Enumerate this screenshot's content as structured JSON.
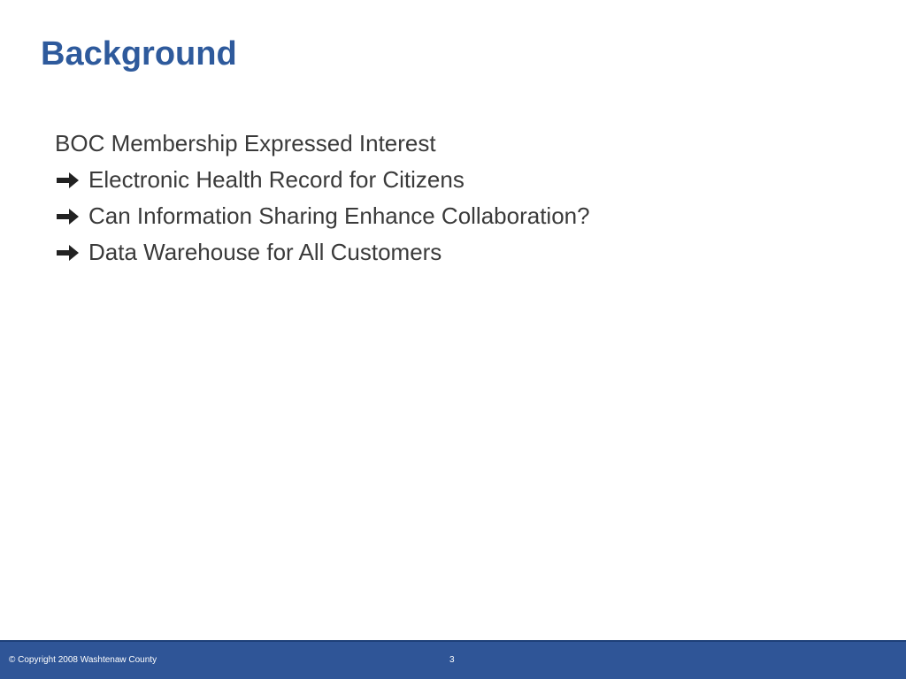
{
  "slide": {
    "title": "Background",
    "lines": [
      {
        "bullet": "",
        "text": "BOC Membership Expressed Interest"
      },
      {
        "bullet": "arrow-right-icon",
        "text": "Electronic Health Record for Citizens"
      },
      {
        "bullet": "arrow-right-icon",
        "text": "Can Information Sharing Enhance Collaboration?"
      },
      {
        "bullet": "arrow-right-icon",
        "text": "Data Warehouse for All Customers"
      }
    ]
  },
  "footer": {
    "copyright": "© Copyright 2008 Washtenaw County",
    "page_number": "3"
  },
  "colors": {
    "title": "#2e5a9c",
    "body_text": "#3a3a3a",
    "footer_bg": "#2f5597",
    "footer_text": "#ffffff"
  }
}
